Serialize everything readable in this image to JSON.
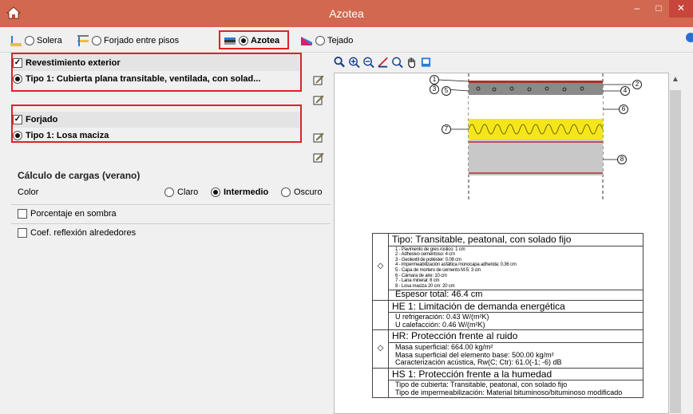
{
  "window": {
    "title": "Azotea",
    "minimize_label": "–",
    "maximize_label": "□",
    "close_label": "✕"
  },
  "topbar": {
    "options": [
      {
        "label": "Solera",
        "selected": false,
        "icon": "solera-icon"
      },
      {
        "label": "Forjado entre pisos",
        "selected": false,
        "icon": "forjado-icon"
      },
      {
        "label": "Azotea",
        "selected": true,
        "icon": "azotea-icon"
      },
      {
        "label": "Tejado",
        "selected": false,
        "icon": "tejado-icon"
      }
    ]
  },
  "revestimiento": {
    "checked": true,
    "label": "Revestimiento exterior",
    "type_label": "Tipo 1: Cubierta plana transitable, ventilada, con solad..."
  },
  "forjado": {
    "checked": true,
    "label": "Forjado",
    "type_label": "Tipo 1: Losa maciza"
  },
  "cargas": {
    "title": "Cálculo de cargas (verano)",
    "color_label": "Color",
    "options": [
      "Claro",
      "Intermedio",
      "Oscuro"
    ],
    "selected": "Intermedio",
    "sombra_label": "Porcentaje en sombra",
    "reflexion_label": "Coef. reflexión alrededores"
  },
  "viewer_tools": [
    "zoom-window-icon",
    "zoom-in-icon",
    "zoom-out-icon",
    "measure-icon",
    "zoom-previous-icon",
    "pan-icon",
    "export-icon"
  ],
  "diagram": {
    "callouts": [
      "1",
      "2",
      "3",
      "4",
      "5",
      "6",
      "7",
      "8"
    ]
  },
  "report": {
    "tipo_header": "Tipo: Transitable, peatonal, con solado fijo",
    "layers": [
      "1 - Pavimento de gres rústico: 1 cm",
      "2 - Adhesivo cementoso: 4 cm",
      "3 - Geotextil de poliéster: 0.08 cm",
      "4 - Impermeabilización asfáltica monocapa adherida: 0.36 cm",
      "5 - Capa de mortero de cemento M-5: 3 cm",
      "6 - Cámara de aire: 10 cm",
      "7 - Lana mineral: 8 cm",
      "8 - Losa maciza 20 cm: 20 cm"
    ],
    "espesor": "Espesor total: 46.4 cm",
    "he1_header": "HE 1: Limitación de demanda energética",
    "he1_lines": [
      "U refrigeración: 0.43 W/(m²K)",
      "U calefacción: 0.46 W/(m²K)"
    ],
    "hr_header": "HR: Protección frente al ruido",
    "hr_lines": [
      "Masa superficial: 664.00 kg/m²",
      "Masa superficial del elemento base: 500.00 kg/m²",
      "Caracterización acústica, Rw(C; Ctr): 61.0(-1; -6) dB"
    ],
    "hs1_header": "HS 1: Protección frente a la humedad",
    "hs1_lines": [
      "Tipo de cubierta: Transitable, peatonal, con solado fijo",
      "Tipo de impermeabilización: Material bituminoso/bituminoso modificado"
    ]
  },
  "colors": {
    "titlebar": "#d2684f",
    "highlight": "#e0202a",
    "insulation": "#f5e61a",
    "slab": "#c8c8c8"
  }
}
